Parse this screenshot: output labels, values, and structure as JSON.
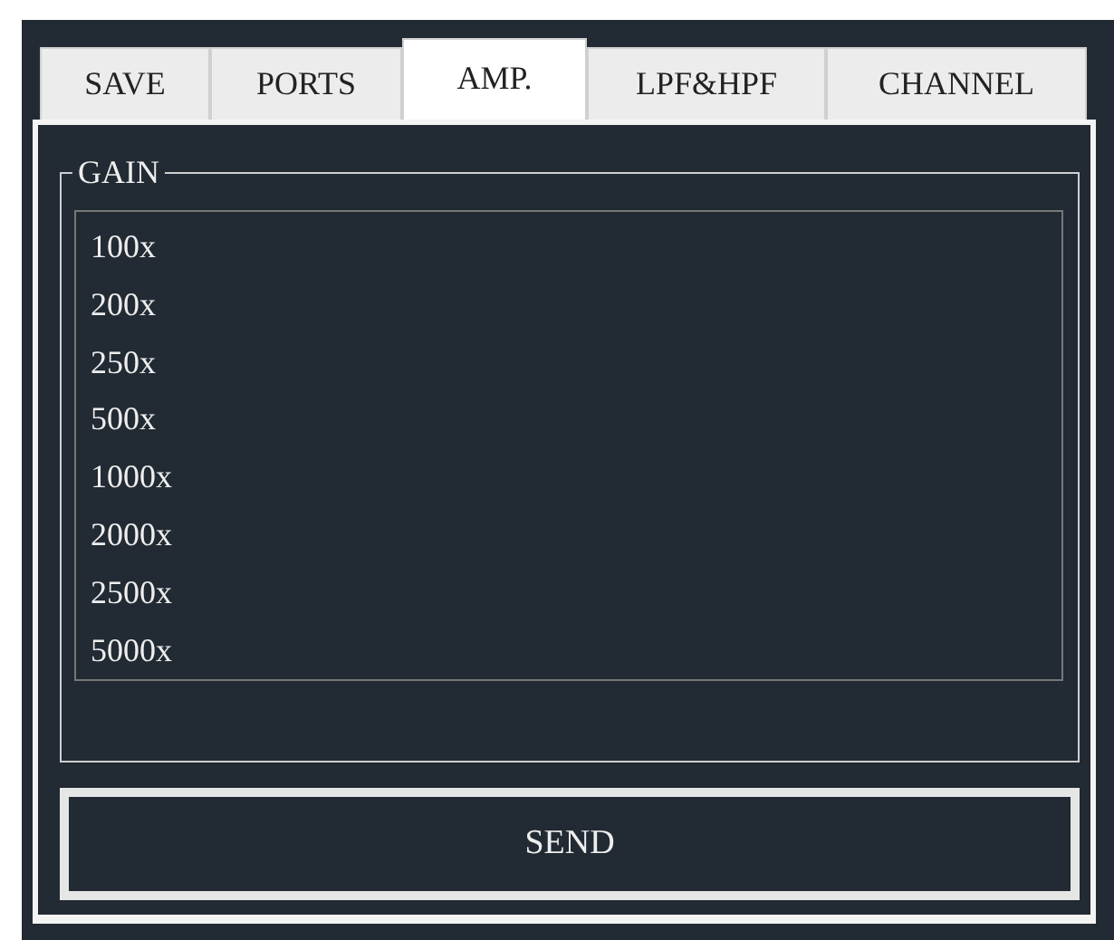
{
  "tabs": [
    {
      "label": "SAVE",
      "selected": false
    },
    {
      "label": "PORTS",
      "selected": false
    },
    {
      "label": "AMP.",
      "selected": true
    },
    {
      "label": "LPF&HPF",
      "selected": false
    },
    {
      "label": "CHANNEL",
      "selected": false
    }
  ],
  "gain": {
    "title": "GAIN",
    "options": [
      "100x",
      "200x",
      "250x",
      "500x",
      "1000x",
      "2000x",
      "2500x",
      "5000x"
    ]
  },
  "button": "SEND"
}
